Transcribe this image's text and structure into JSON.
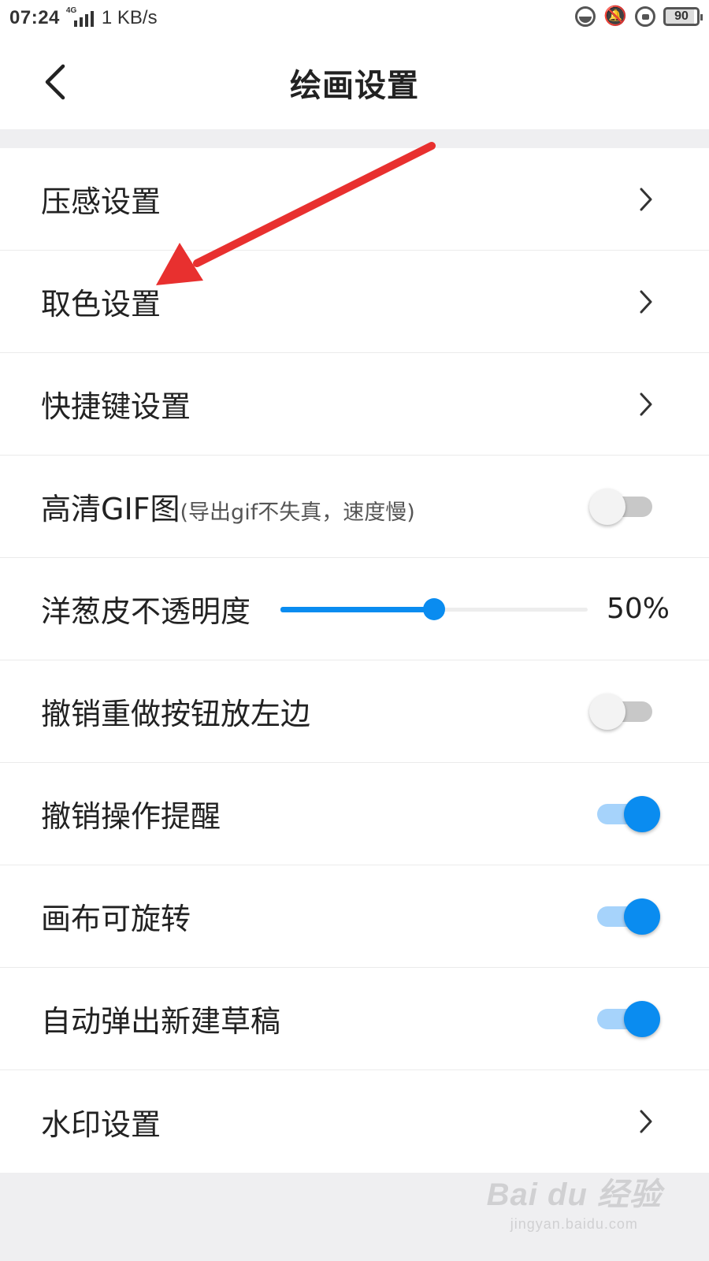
{
  "status": {
    "time": "07:24",
    "network": "4G",
    "speed": "1 KB/s",
    "battery": "90"
  },
  "header": {
    "title": "绘画设置"
  },
  "settings": [
    {
      "label": "压感设置",
      "type": "link"
    },
    {
      "label": "取色设置",
      "type": "link"
    },
    {
      "label": "快捷键设置",
      "type": "link"
    },
    {
      "label": "高清GIF图",
      "sublabel": "(导出gif不失真，速度慢)",
      "type": "toggle",
      "on": false
    },
    {
      "label": "洋葱皮不透明度",
      "type": "slider",
      "value": 0.5,
      "value_text": "50%"
    },
    {
      "label": "撤销重做按钮放左边",
      "type": "toggle",
      "on": false
    },
    {
      "label": "撤销操作提醒",
      "type": "toggle",
      "on": true
    },
    {
      "label": "画布可旋转",
      "type": "toggle",
      "on": true
    },
    {
      "label": "自动弹出新建草稿",
      "type": "toggle",
      "on": true
    },
    {
      "label": "水印设置",
      "type": "link"
    }
  ],
  "watermark": {
    "brand": "Bai  du 经验",
    "domain": "jingyan.baidu.com"
  },
  "colors": {
    "accent": "#0a8cf0",
    "annotation_arrow": "#e8302f"
  }
}
